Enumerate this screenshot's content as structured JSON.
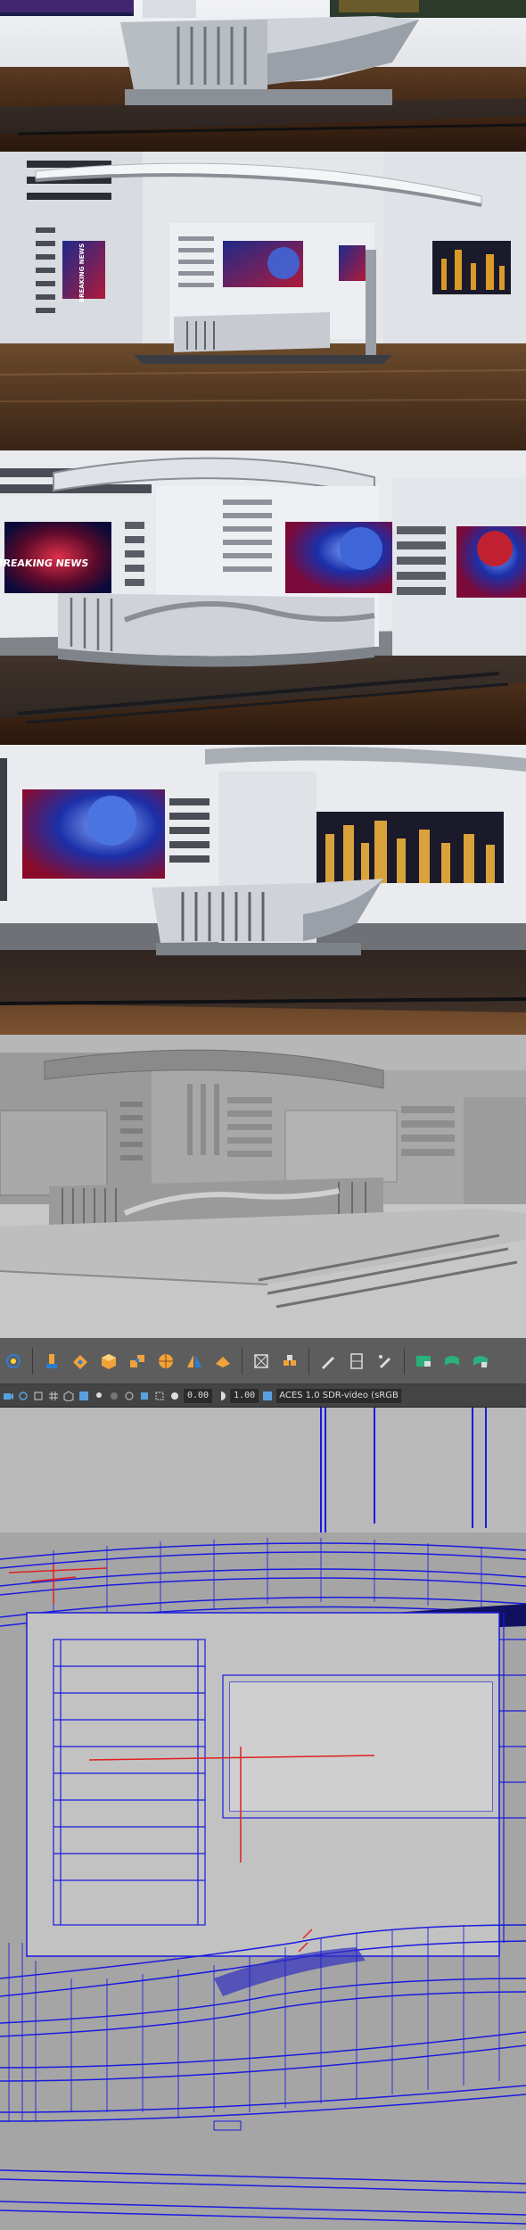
{
  "panels": [
    {
      "name": "render-view-1",
      "screens": []
    },
    {
      "name": "render-view-2",
      "screens": [
        "left-wall-screen",
        "center-globe-screen",
        "right-city-screen"
      ],
      "left_screen_text": "BREAKING NEWS"
    },
    {
      "name": "render-view-3",
      "screens": [
        "breaking-news-screen",
        "globe-screen",
        "right-globe-screen"
      ],
      "screen_text": "BREAKING NEWS"
    },
    {
      "name": "render-view-4",
      "screens": [
        "globe-screen",
        "city-screen"
      ]
    },
    {
      "name": "clay-render-view-5",
      "screens": []
    }
  ],
  "toolbar": {
    "tools": [
      "smoothing-icon",
      "extrude-icon",
      "bevel-icon",
      "cube-icon",
      "combine-icon",
      "sphere-icon",
      "mirror-icon",
      "bridge-icon",
      "target-weld-icon",
      "multicut-icon",
      "soft-select-icon",
      "pen-icon",
      "edge-loop-icon",
      "paint-icon",
      "uv-editor-icon",
      "uv-layout-icon",
      "uv-unfold-icon"
    ]
  },
  "toolbar2": {
    "exposure_value": "0.00",
    "gamma_value": "1.00",
    "color_space": "ACES 1.0 SDR-video (sRGB"
  },
  "colors": {
    "wood_dark": "#3a2416",
    "wood_light": "#7a5230",
    "wall": "#e6e8ec",
    "wire_blue": "#1a1ae0",
    "screen_red": "#c0122a",
    "screen_blue": "#2a44d8",
    "clay_grey": "#a4a4a4"
  }
}
